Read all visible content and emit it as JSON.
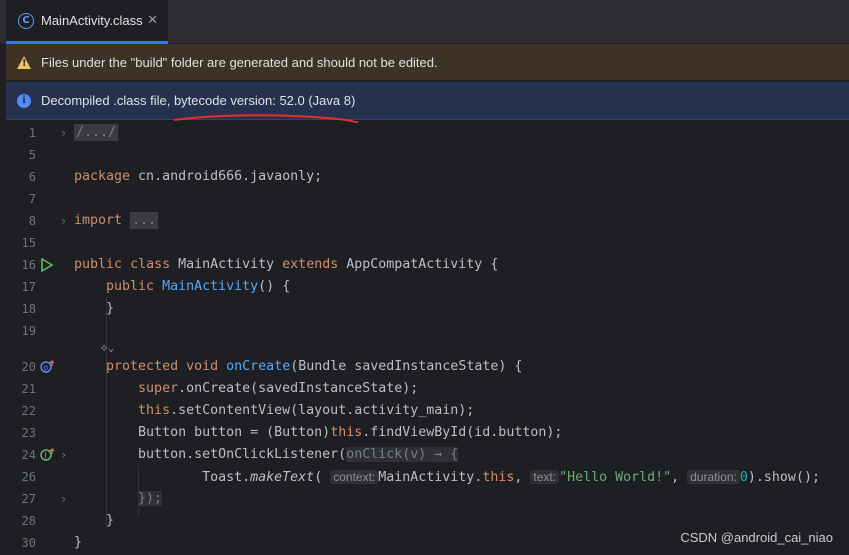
{
  "tab": {
    "label": "MainActivity.class",
    "icon": "class-c-icon",
    "close": "✕"
  },
  "banners": {
    "warning": "Files under the \"build\" folder are generated and should not be edited.",
    "info": "Decompiled .class file, bytecode version: 52.0 (Java 8)"
  },
  "line_numbers": [
    "1",
    "5",
    "6",
    "7",
    "8",
    "15",
    "16",
    "17",
    "18",
    "19",
    "",
    "20",
    "21",
    "22",
    "23",
    "24",
    "26",
    "27",
    "28",
    "30"
  ],
  "code": {
    "l1": "/.../",
    "l6_kw": "package",
    "l6_rest": " cn.android666.javaonly;",
    "l8_kw": "import",
    "l8_fold": "...",
    "l16_kw1": "public",
    "l16_kw2": "class",
    "l16_name": " MainActivity ",
    "l16_kw3": "extends",
    "l16_rest": " AppCompatActivity {",
    "l17_kw": "public",
    "l17_fn": "MainActivity",
    "l17_rest": "() {",
    "l18": "}",
    "l19_hint": "⟡⌄",
    "l20_kw1": "protected",
    "l20_kw2": "void",
    "l20_fn": "onCreate",
    "l20_rest": "(Bundle savedInstanceState) {",
    "l21_kw": "super",
    "l21_rest": ".onCreate(savedInstanceState);",
    "l22_kw": "this",
    "l22_rest": ".setContentView(layout.activity_main);",
    "l23_a": "Button button = (Button)",
    "l23_kw": "this",
    "l23_b": ".findViewById(id.button);",
    "l24_a": "button.setOnClickListener(",
    "l24_lambda": "onClick(v) → {",
    "l26_a": "Toast.",
    "l26_it": "makeText",
    "l26_b": "(",
    "l26_hint1": "context:",
    "l26_c": "MainActivity.",
    "l26_kw": "this",
    "l26_d": ",",
    "l26_hint2": "text:",
    "l26_str": "\"Hello World!\"",
    "l26_e": ",",
    "l26_hint3": "duration:",
    "l26_num": "0",
    "l26_f": ").show();",
    "l27": "});",
    "l28": "}",
    "l30": "}"
  },
  "watermark": "CSDN @android_cai_niao",
  "colors": {
    "keyword": "#cf8e6d",
    "function": "#56a8f5",
    "string": "#6aab73",
    "number": "#2aacb8",
    "accent": "#3574f0"
  }
}
